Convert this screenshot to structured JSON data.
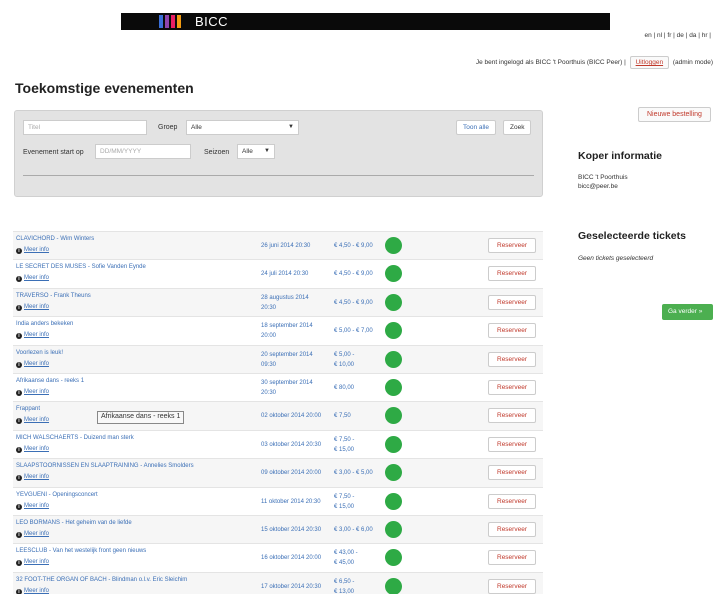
{
  "header": {
    "logo_text": "BICC",
    "languages": "en | nl | fr | de | da | hr |",
    "login_text": "Je bent ingelogd als BICC 't Poorthuis (BICC Peer) |",
    "logout_label": "Uitloggen",
    "mode_text": "(admin mode)",
    "logo_colors": [
      "#3a6fd8",
      "#8e44ad",
      "#e91e63",
      "#f39c12"
    ]
  },
  "page_title": "Toekomstige evenementen",
  "filter": {
    "title_placeholder": "Titel",
    "group_label": "Groep",
    "group_value": "Alle",
    "show_all_label": "Toon alle",
    "search_label": "Zoek",
    "start_label": "Evenement start op",
    "date_placeholder": "DD/MM/YYYY",
    "season_label": "Seizoen",
    "season_value": "Alle"
  },
  "side": {
    "new_order_label": "Nieuwe bestelling",
    "buyer_heading": "Koper informatie",
    "buyer_name": "BICC 't Poorthuis",
    "buyer_email": "bicc@peer.be",
    "tickets_heading": "Geselecteerde tickets",
    "no_tickets": "Geen tickets geselecteerd",
    "continue_label": "Ga verder »"
  },
  "events": [
    {
      "title": "CLAVICHORD - Wim Winters",
      "date": [
        "26 juni 2014 20:30"
      ],
      "price": [
        "€ 4,50 - € 9,00"
      ]
    },
    {
      "title": "LE SECRET DES MUSES - Sofie Vanden Eynde",
      "date": [
        "24 juli 2014 20:30"
      ],
      "price": [
        "€ 4,50 - € 9,00"
      ]
    },
    {
      "title": "TRAVERSO - Frank Theuns",
      "date": [
        "28 augustus 2014",
        "20:30"
      ],
      "price": [
        "€ 4,50 - € 9,00"
      ]
    },
    {
      "title": "India anders bekeken",
      "date": [
        "18 september 2014",
        "20:00"
      ],
      "price": [
        "€ 5,00 - € 7,00"
      ]
    },
    {
      "title": "Voorlezen is leuk!",
      "date": [
        "20 september 2014",
        "09:30"
      ],
      "price": [
        "€ 5,00 -",
        "€ 10,00"
      ]
    },
    {
      "title": "Afrikaanse dans - reeks 1",
      "date": [
        "30 september 2014",
        "20:30"
      ],
      "price": [
        "€ 80,00"
      ]
    },
    {
      "title": "Frappant",
      "date": [
        "02 oktober 2014 20:00"
      ],
      "price": [
        "€ 7,50"
      ]
    },
    {
      "title": "MICH WALSCHAERTS - Duizend man sterk",
      "date": [
        "03 oktober 2014 20:30"
      ],
      "price": [
        "€ 7,50 -",
        "€ 15,00"
      ]
    },
    {
      "title": "SLAAPSTOORNISSEN EN SLAAPTRAINING - Annelies Smolders",
      "date": [
        "09 oktober 2014 20:00"
      ],
      "price": [
        "€ 3,00 - € 5,00"
      ]
    },
    {
      "title": "YEVGUENI - Openingsconcert",
      "date": [
        "11 oktober 2014 20:30"
      ],
      "price": [
        "€ 7,50 -",
        "€ 15,00"
      ]
    },
    {
      "title": "LEO BORMANS - Het geheim van de liefde",
      "date": [
        "15 oktober 2014 20:30"
      ],
      "price": [
        "€ 3,00 - € 6,00"
      ]
    },
    {
      "title": "LEESCLUB - Van het westelijk front geen nieuws",
      "date": [
        "16 oktober 2014 20:00"
      ],
      "price": [
        "€ 43,00 -",
        "€ 45,00"
      ]
    },
    {
      "title": "32 FOOT-THE ORGAN OF BACH - Blindman o.l.v. Eric Sleichim",
      "date": [
        "17 oktober 2014 20:30"
      ],
      "price": [
        "€ 6,50 -",
        "€ 13,00"
      ]
    }
  ],
  "row_more_label": "Meer info",
  "row_reserve_label": "Reserveer",
  "status_color": "#2eaa45",
  "tooltip_text": "Afrikaanse dans - reeks 1"
}
